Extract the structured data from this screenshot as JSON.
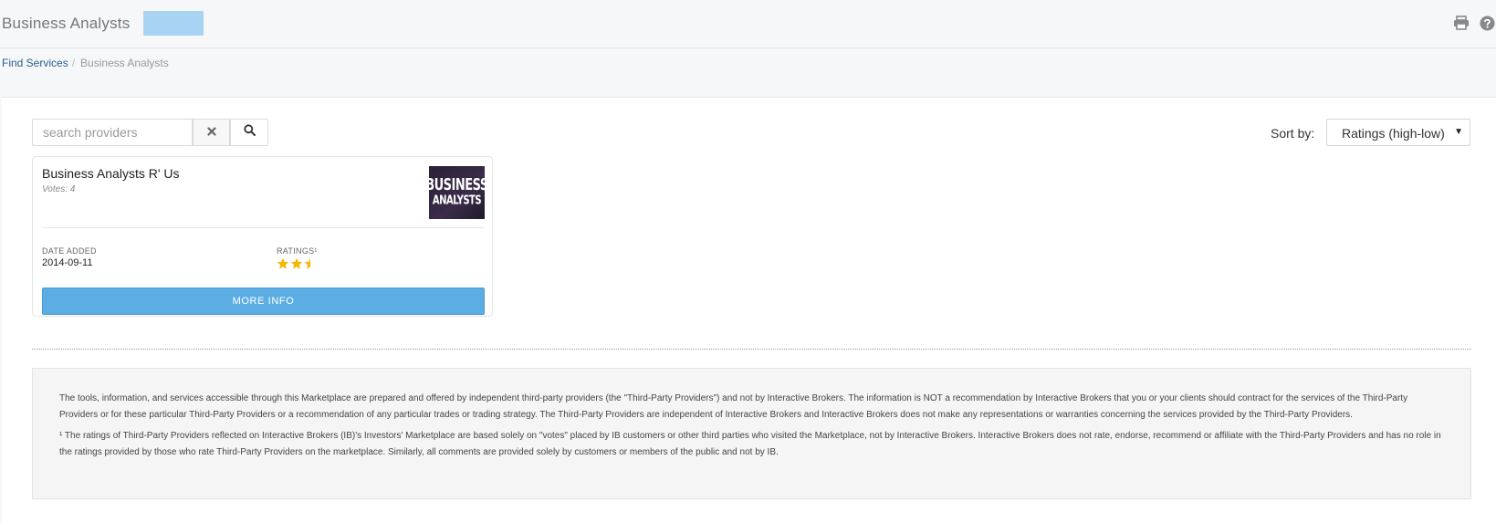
{
  "header": {
    "title": "Business Analysts",
    "print_icon": "print-icon",
    "help_icon": "help-icon"
  },
  "breadcrumb": {
    "items": [
      "Find Services",
      "Business Analysts"
    ],
    "separator": "/"
  },
  "search": {
    "placeholder": "search providers",
    "value": "",
    "clear_icon": "close-icon",
    "search_icon": "search-icon"
  },
  "sort": {
    "label": "Sort by:",
    "selected": "Ratings (high-low)",
    "caret": "▼"
  },
  "providers": [
    {
      "name": "Business Analysts R' Us",
      "votes": "Votes: 4",
      "logo_lines": [
        "BUSINESS",
        "ANALYSTS"
      ],
      "date_added_label": "DATE ADDED",
      "date_added": "2014-09-11",
      "ratings_label": "RATINGS¹",
      "rating": 2.5,
      "rating_max": 3,
      "more_info_label": "MORE INFO"
    }
  ],
  "disclaimer": {
    "paragraph_1": "The tools, information, and services accessible through this Marketplace are prepared and offered by independent third-party providers (the \"Third-Party Providers\") and not by Interactive Brokers. The information is NOT a recommendation by Interactive Brokers that you or your clients should contract for the services of the Third-Party Providers or for these particular Third-Party Providers or a recommendation of any particular trades or trading strategy. The Third-Party Providers are independent of Interactive Brokers and Interactive Brokers does not make any representations or warranties concerning the services provided by the Third-Party Providers.",
    "paragraph_2": "¹ The ratings of Third-Party Providers reflected on Interactive Brokers (IB)'s Investors' Marketplace are based solely on \"votes\" placed by IB customers or other third parties who visited the Marketplace, not by Interactive Brokers. Interactive Brokers does not rate, endorse, recommend or affiliate with the Third-Party Providers and has no role in the ratings provided by those who rate Third-Party Providers on the marketplace. Similarly, all comments are provided solely by customers or members of the public and not by IB."
  },
  "colors": {
    "accent_button": "#5dade5",
    "star": "#f5b800",
    "link": "#2a5d8f",
    "badge": "#a9d3f2"
  }
}
